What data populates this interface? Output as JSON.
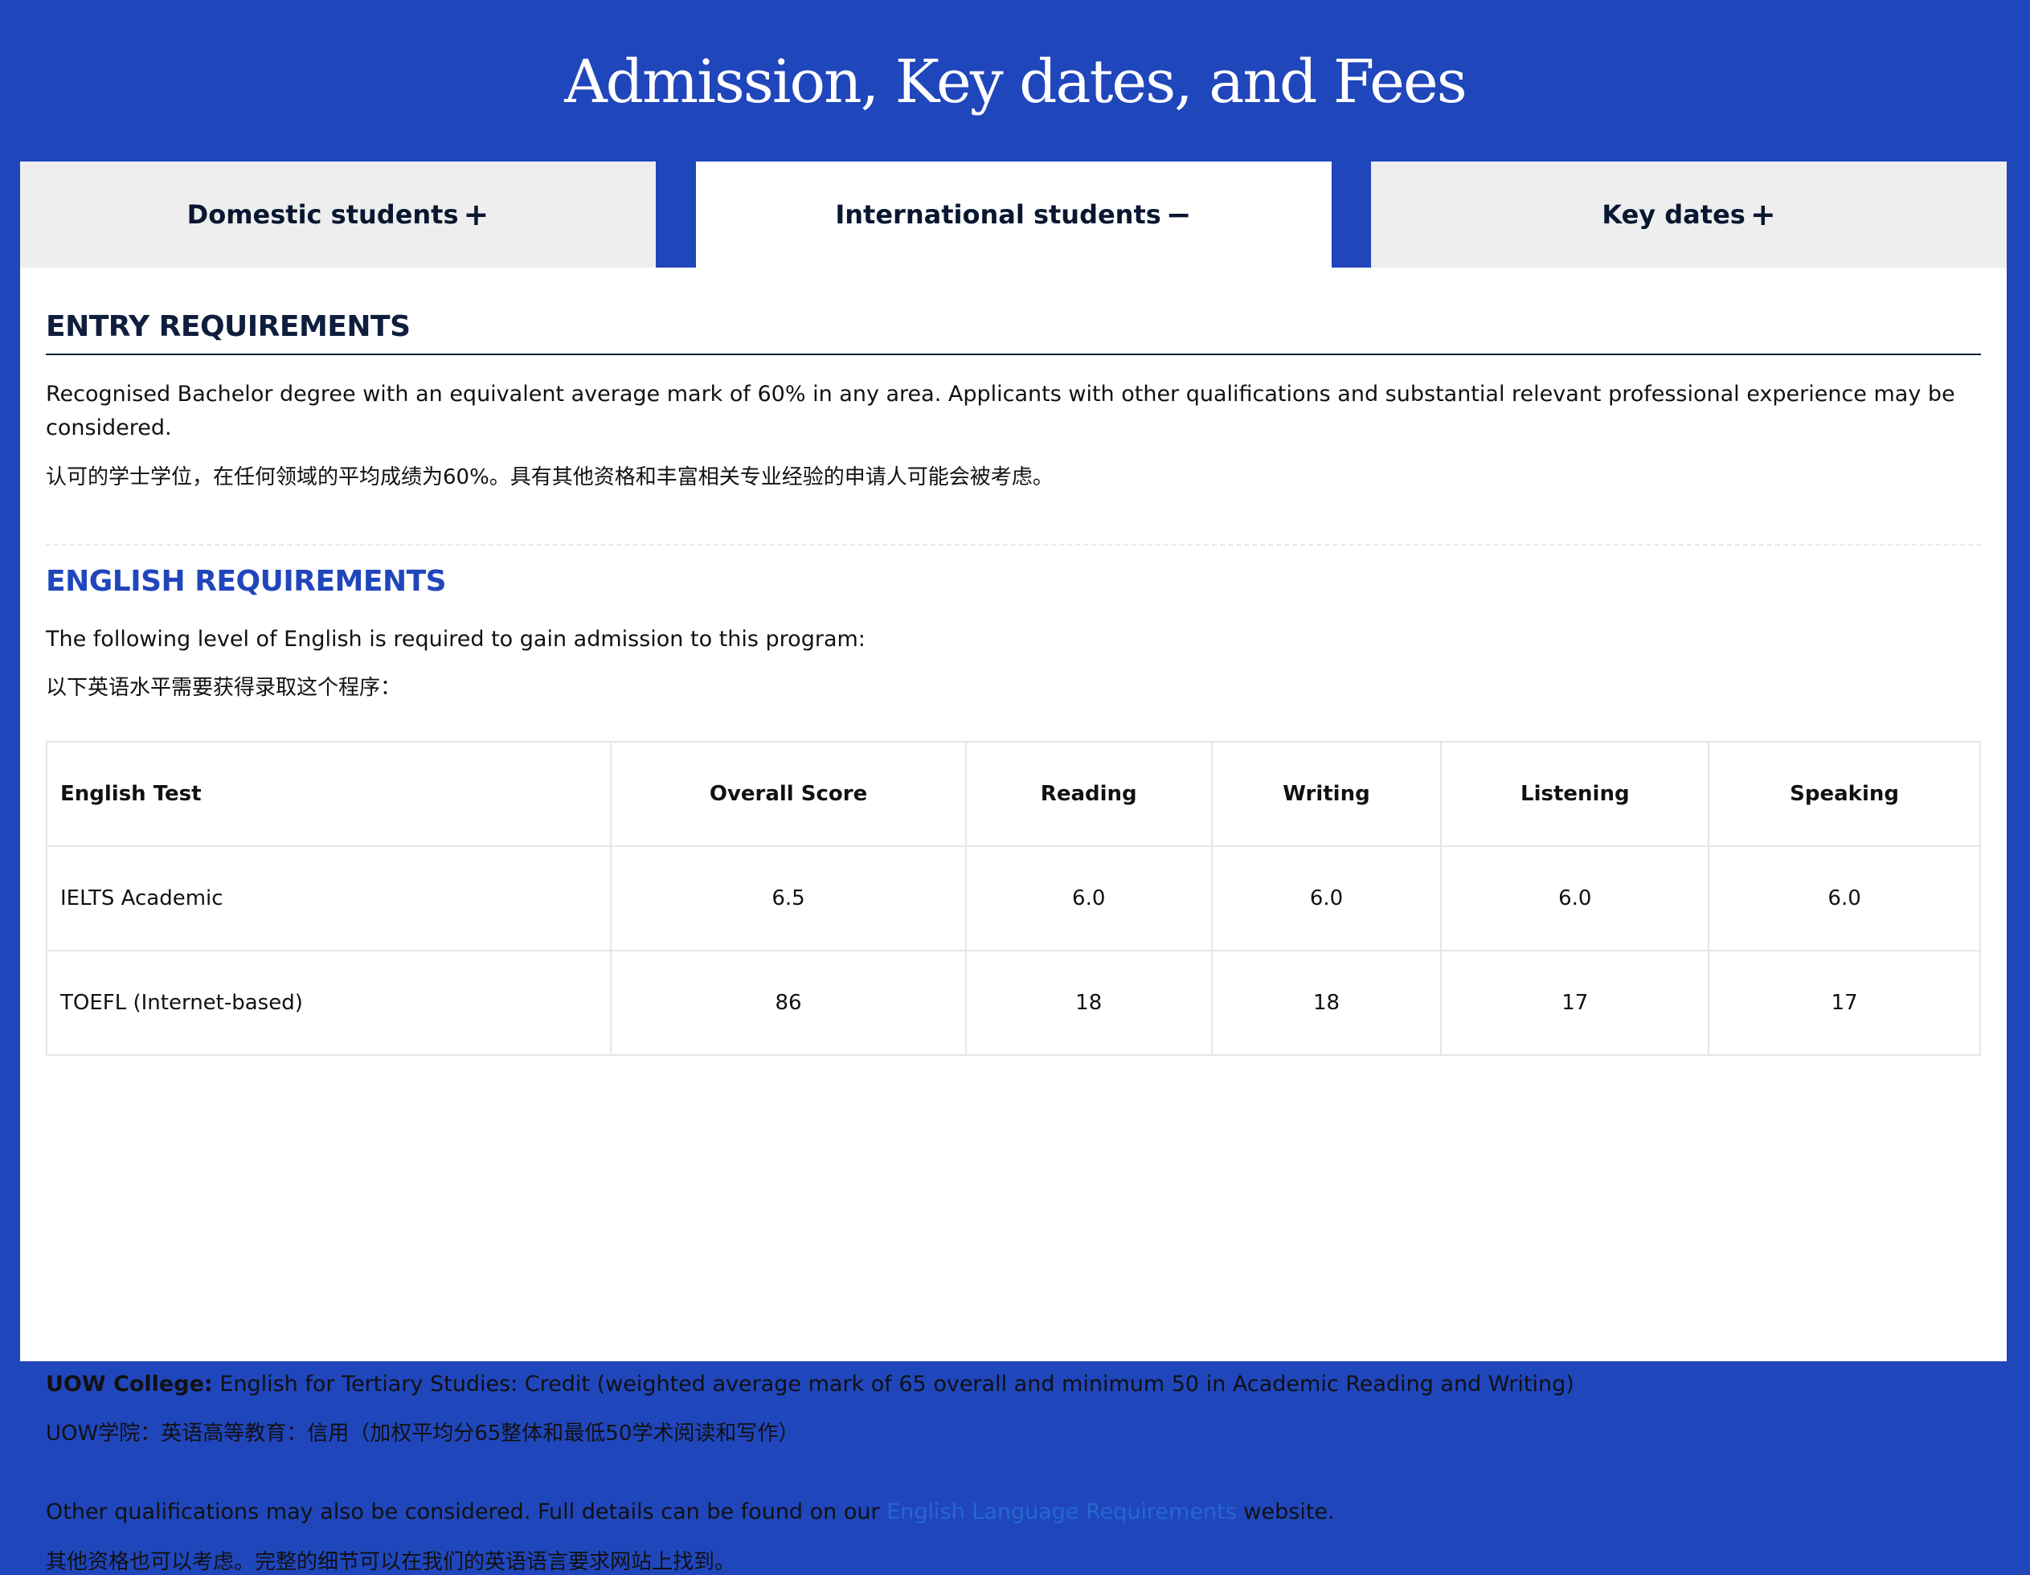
{
  "header": {
    "title": "Admission, Key dates, and Fees"
  },
  "tabs": [
    {
      "label": "Domestic students",
      "symbol": "+",
      "state": "collapsed"
    },
    {
      "label": "International students",
      "symbol": "−",
      "state": "expanded"
    },
    {
      "label": "Key dates",
      "symbol": "+",
      "state": "collapsed"
    }
  ],
  "entry": {
    "title": "ENTRY REQUIREMENTS",
    "text": "Recognised Bachelor degree with an equivalent average mark of 60% in any area. Applicants with other qualifications and substantial relevant professional experience may be considered.",
    "text_cn": "认可的学士学位，在任何领域的平均成绩为60%。具有其他资格和丰富相关专业经验的申请人可能会被考虑。"
  },
  "english": {
    "title": "ENGLISH REQUIREMENTS",
    "intro": "The following level of English is required to gain admission to this program:",
    "intro_cn": "以下英语水平需要获得录取这个程序：",
    "table": {
      "headers": [
        "English Test",
        "Overall Score",
        "Reading",
        "Writing",
        "Listening",
        "Speaking"
      ],
      "rows": [
        [
          "IELTS Academic",
          "6.5",
          "6.0",
          "6.0",
          "6.0",
          "6.0"
        ],
        [
          "TOEFL (Internet-based)",
          "86",
          "18",
          "18",
          "17",
          "17"
        ]
      ]
    },
    "college_label": "UOW College:",
    "college_text": "English for Tertiary Studies: Credit (weighted average mark of 65 overall and minimum 50 in Academic Reading and Writing)",
    "college_cn": "UOW学院：英语高等教育：信用（加权平均分65整体和最低50学术阅读和写作）",
    "other_text_before": "Other qualifications may also be considered. Full details can be found on our",
    "other_link": "English Language Requirements",
    "other_text_after": "website.",
    "other_cn": "其他资格也可以考虑。完整的细节可以在我们的英语语言要求网站上找到。"
  },
  "colors": {
    "brand_blue": "#2046bc",
    "heading_navy": "#0f1e3d",
    "link_blue": "#2468cf",
    "tab_inactive": "#eeeeee"
  }
}
